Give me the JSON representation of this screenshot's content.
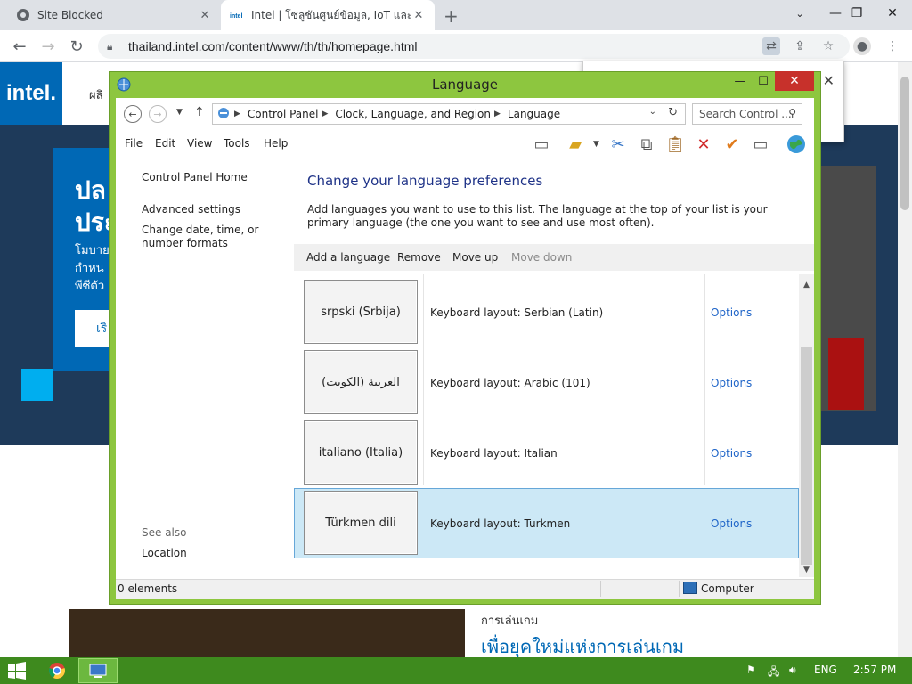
{
  "browser": {
    "tabs": [
      {
        "title": "Site Blocked",
        "active": false
      },
      {
        "title": "Intel | โซลูชันศูนย์ข้อมูล, IoT และพีซี",
        "active": true
      }
    ],
    "new_tab": "+",
    "url": "thailand.intel.com/content/www/th/th/homepage.html",
    "controls": {
      "minimize": "—",
      "restore": "❐",
      "close": "✕"
    }
  },
  "intel_page": {
    "logo": "intel.",
    "nav_fragment": "ผลิ",
    "hero_title": "ปล\nประ",
    "hero_text": "โมบาย\nกำหน\nพีซีตัว",
    "hero_button": "เริ",
    "game_caption": "การเล่นเกม",
    "game_title": "เพื่อยุคใหม่แห่งการเล่นเกม"
  },
  "window": {
    "title": "Language",
    "breadcrumb": [
      "Control Panel",
      "Clock, Language, and Region",
      "Language"
    ],
    "search_placeholder": "Search Control ...",
    "menu": [
      "File",
      "Edit",
      "View",
      "Tools",
      "Help"
    ],
    "left_links": [
      "Control Panel Home",
      "Advanced settings",
      "Change date, time, or number formats"
    ],
    "see_also_label": "See also",
    "see_also_links": [
      "Location"
    ],
    "heading": "Change your language preferences",
    "description": "Add languages you want to use to this list. The language at the top of your list is your primary language (the one you want to see and use most often).",
    "commands": [
      {
        "label": "Add a language",
        "enabled": true
      },
      {
        "label": "Remove",
        "enabled": true
      },
      {
        "label": "Move up",
        "enabled": true
      },
      {
        "label": "Move down",
        "enabled": false
      }
    ],
    "languages": [
      {
        "name": "srpski (Srbija)",
        "keyboard": "Keyboard layout: Serbian (Latin)",
        "options": "Options",
        "selected": false
      },
      {
        "name": "العربية (الكويت)",
        "keyboard": "Keyboard layout: Arabic (101)",
        "options": "Options",
        "selected": false
      },
      {
        "name": "italiano (Italia)",
        "keyboard": "Keyboard layout: Italian",
        "options": "Options",
        "selected": false
      },
      {
        "name": "Türkmen dili",
        "keyboard": "Keyboard layout: Turkmen",
        "options": "Options",
        "selected": true
      }
    ],
    "status_left": "0 elements",
    "status_right": "Computer"
  },
  "taskbar": {
    "lang": "ENG",
    "time": "2:57 PM"
  },
  "colors": {
    "window_frame": "#8dc63f",
    "taskbar": "#3e8a1e",
    "selection": "#cce8f6",
    "link": "#1e64c8",
    "intel_blue": "#0068b5"
  }
}
